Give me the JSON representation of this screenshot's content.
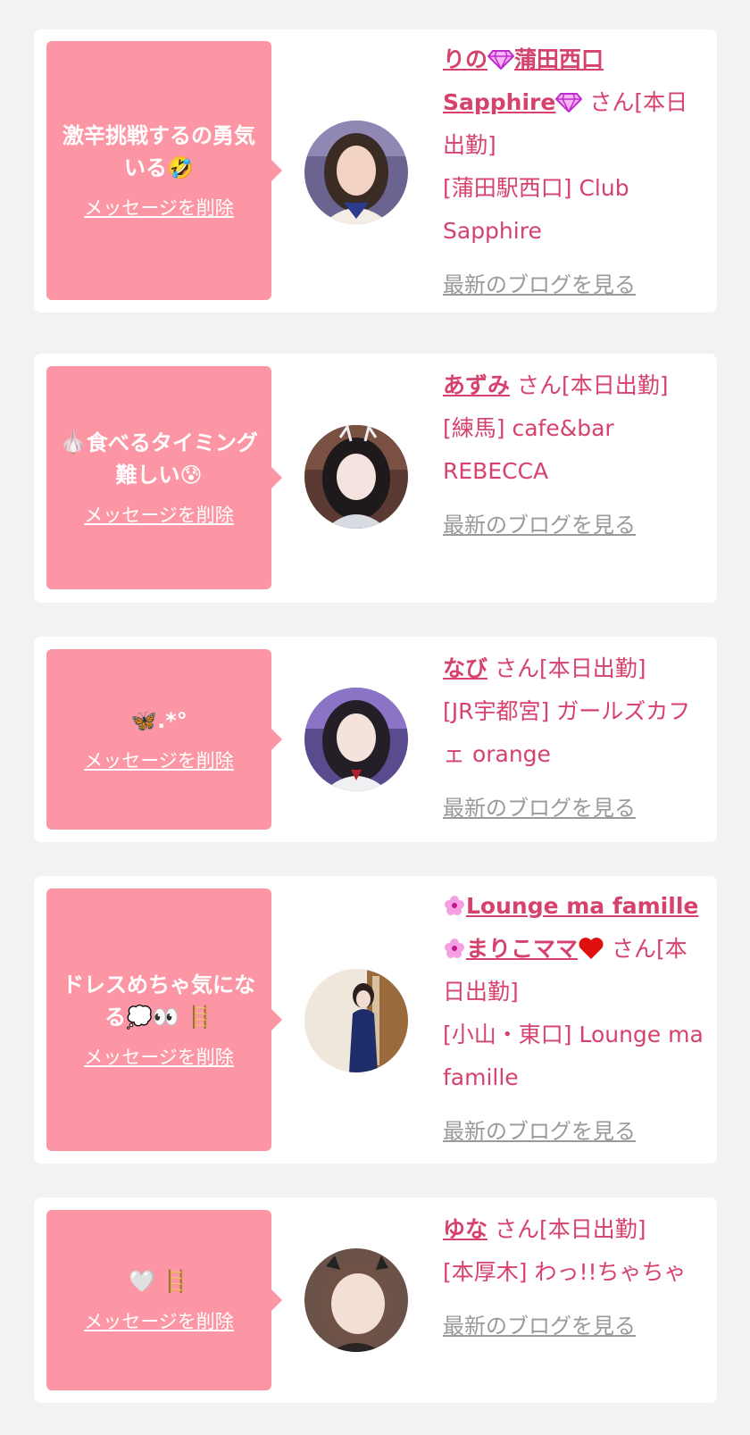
{
  "colors": {
    "page_bg": "#f2f2f2",
    "card_bg": "#ffffff",
    "bubble_bg": "#fd96a4",
    "accent_text": "#d6426d",
    "blog_link": "#9a9a9a"
  },
  "cards": [
    {
      "message": "激辛挑戦するの勇気いる🤣",
      "delete_label": "メッセージを削除",
      "name_before_icon": "りの",
      "name_mid": "蒲田西口 Sapphire",
      "icons": [
        "gem-icon",
        "gem-icon"
      ],
      "san": "さん[本日出勤]",
      "shop": "[蒲田駅西口] Club Sapphire",
      "blog_label": "最新のブログを見る"
    },
    {
      "message": "🧄食べるタイミング難しい😰",
      "delete_label": "メッセージを削除",
      "name": "あずみ",
      "san": "さん[本日出勤]",
      "shop": "[練馬] cafe&bar REBECCA",
      "blog_label": "最新のブログを見る"
    },
    {
      "message": "🦋.*°",
      "delete_label": "メッセージを削除",
      "name": "なび",
      "san": "さん[本日出勤]",
      "shop": "[JR宇都宮] ガールズカフェ orange",
      "blog_label": "最新のブログを見る"
    },
    {
      "message": "ドレスめちゃ気になる💭👀 🪜",
      "delete_label": "メッセージを削除",
      "name_line1": "Lounge ma famille",
      "name_line2": "まりこママ",
      "icons": [
        "flower-icon",
        "flower-icon",
        "heart-icon"
      ],
      "san": "さん[本日出勤]",
      "shop": "[小山・東口] Lounge ma famille",
      "blog_label": "最新のブログを見る"
    },
    {
      "message": "🤍 🪜",
      "delete_label": "メッセージを削除",
      "name": "ゆな",
      "san": "さん[本日出勤]",
      "shop": "[本厚木] わっ!!ちゃちゃ",
      "blog_label": "最新のブログを見る"
    }
  ]
}
